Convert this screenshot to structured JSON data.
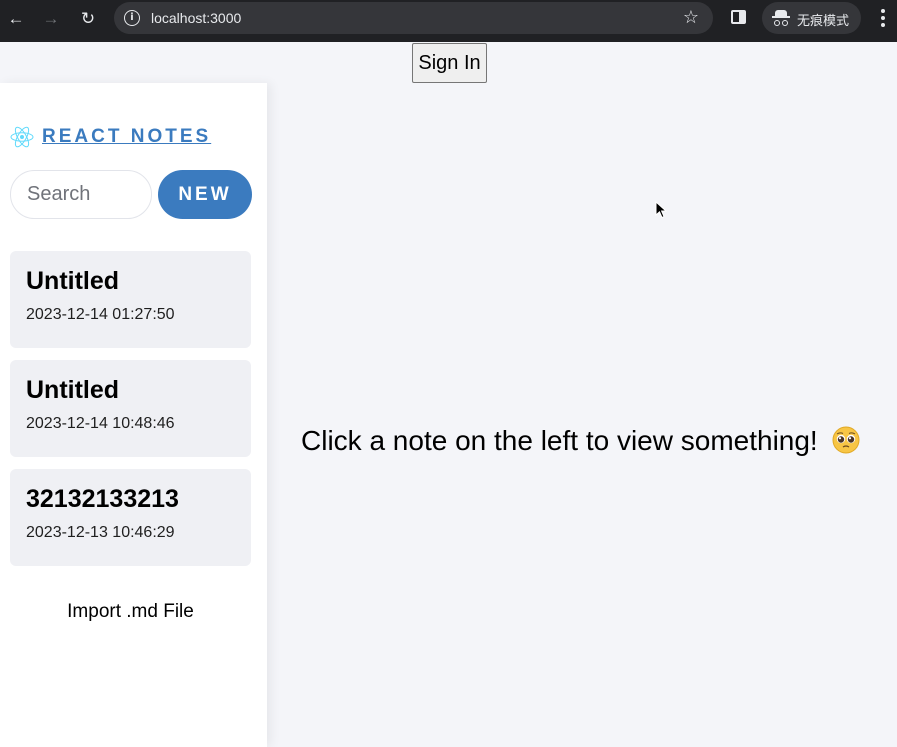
{
  "browser": {
    "url": "localhost:3000",
    "incognito_label": "无痕模式",
    "icons": [
      "back-arrow-icon",
      "forward-arrow-icon",
      "reload-icon",
      "info-icon",
      "star-icon",
      "side-panel-icon",
      "incognito-icon",
      "more-menu-icon"
    ]
  },
  "header": {
    "signin_label": "Sign In"
  },
  "sidebar": {
    "brand": "React Notes",
    "search_placeholder": "Search",
    "new_label": "NEW",
    "notes": [
      {
        "title": "Untitled",
        "date": "2023-12-14 01:27:50"
      },
      {
        "title": "Untitled",
        "date": "2023-12-14 10:48:46"
      },
      {
        "title": "32132133213",
        "date": "2023-12-13 10:46:29"
      }
    ],
    "import_label": "Import .md File"
  },
  "main": {
    "empty_message": "Click a note on the left to view something!"
  },
  "colors": {
    "accent": "#3b7bbf",
    "page_bg": "#f4f5f9",
    "note_bg": "#eff0f4",
    "chrome_bg": "#202124"
  }
}
